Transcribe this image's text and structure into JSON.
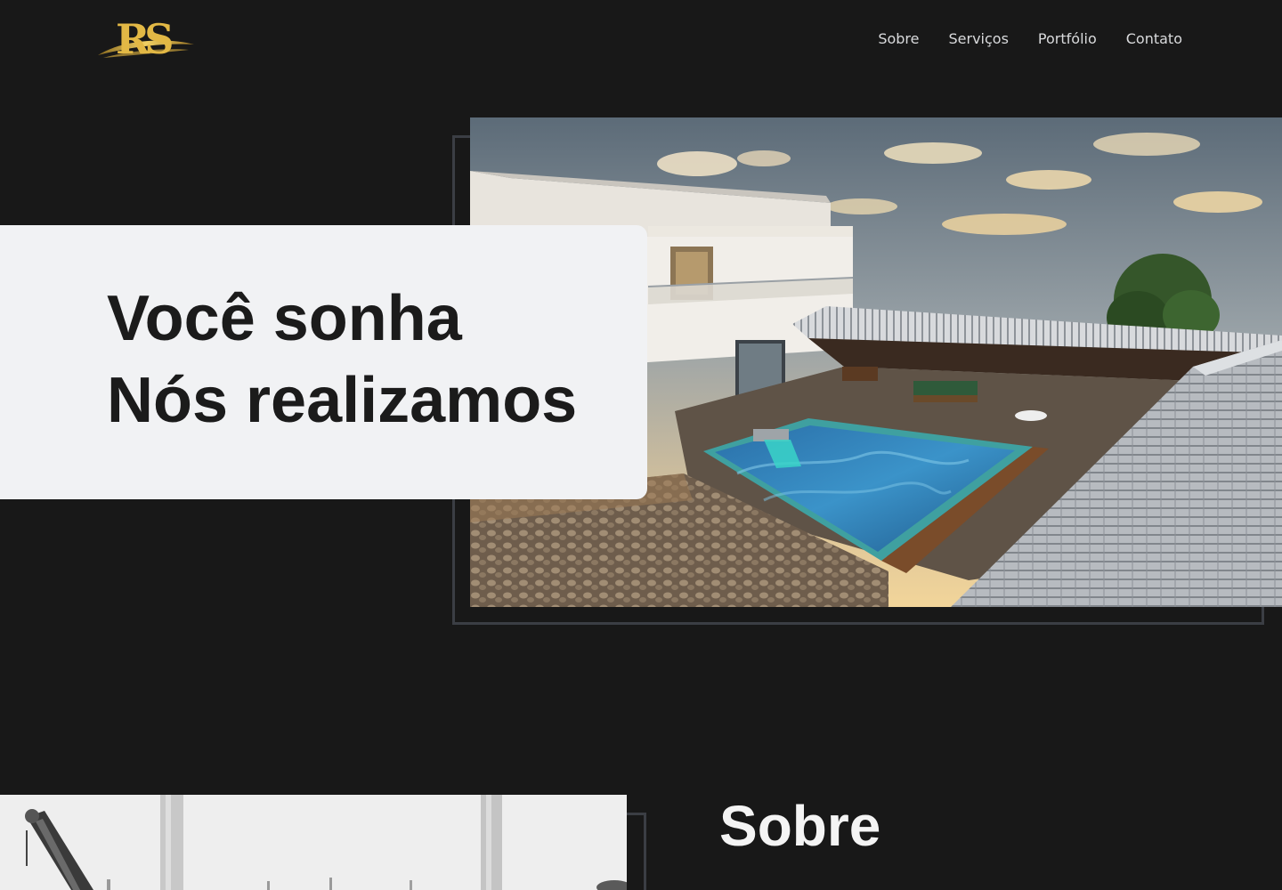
{
  "header": {
    "logo_text": "RS",
    "nav": [
      {
        "label": "Sobre"
      },
      {
        "label": "Serviços"
      },
      {
        "label": "Portfólio"
      },
      {
        "label": "Contato"
      }
    ]
  },
  "hero": {
    "line1": "Você sonha",
    "line2": "Nós realizamos"
  },
  "about": {
    "title": "Sobre"
  },
  "colors": {
    "background": "#181818",
    "card": "#f1f2f4",
    "frame": "#3b3e44",
    "logo_gold": "#e2b845",
    "nav_text": "#d9dadc"
  },
  "icons": [
    "rs-logo"
  ]
}
